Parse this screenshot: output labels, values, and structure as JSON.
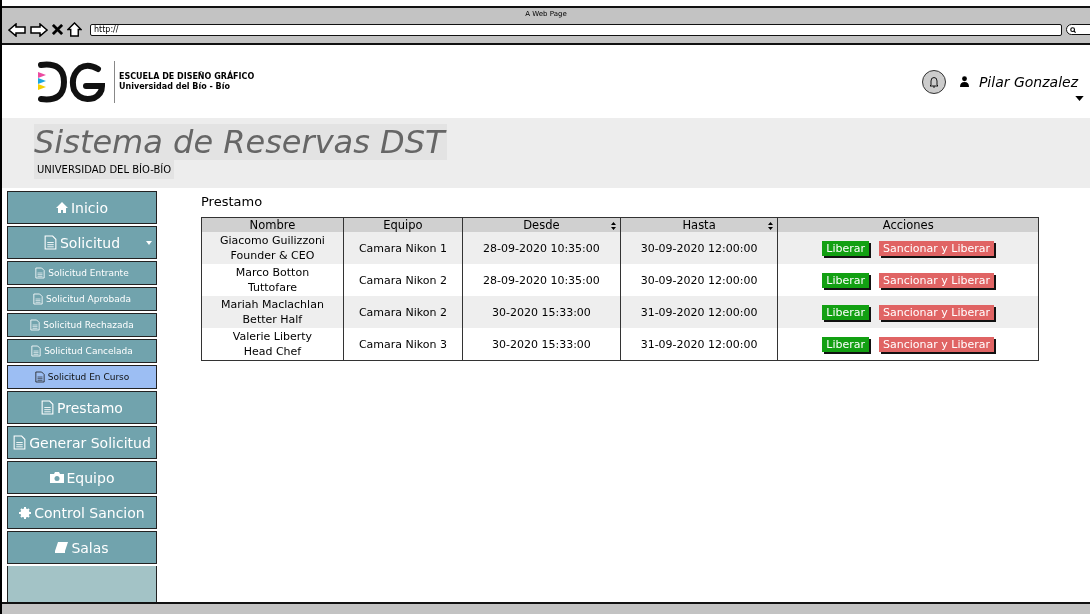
{
  "browser": {
    "title": "A Web Page",
    "url": "http://"
  },
  "header": {
    "logo_lines": [
      "ESCUELA DE DISEÑO GRÁFICO",
      "Universidad del Bío - Bío"
    ],
    "user": "Pilar Gonzalez"
  },
  "banner": {
    "title": "Sistema de Reservas DST",
    "subtitle": "UNIVERSIDAD DEL BÍO-BÍO"
  },
  "sidebar": {
    "items": [
      {
        "label": "Inicio",
        "kind": "main",
        "selected": false,
        "expanded": false
      },
      {
        "label": "Solicitud",
        "kind": "main",
        "selected": false,
        "expanded": true
      },
      {
        "label": "Solicitud Entrante",
        "kind": "sub",
        "selected": false,
        "expanded": false
      },
      {
        "label": "Solicitud Aprobada",
        "kind": "sub",
        "selected": false,
        "expanded": false
      },
      {
        "label": "Solicitud Rechazada",
        "kind": "sub",
        "selected": false,
        "expanded": false
      },
      {
        "label": "Solicitud Cancelada",
        "kind": "sub",
        "selected": false,
        "expanded": false
      },
      {
        "label": "Solicitud En Curso",
        "kind": "sub",
        "selected": true,
        "expanded": false
      },
      {
        "label": "Prestamo",
        "kind": "main",
        "selected": false,
        "expanded": false
      },
      {
        "label": "Generar Solicitud",
        "kind": "main",
        "selected": false,
        "expanded": false
      },
      {
        "label": "Equipo",
        "kind": "main",
        "selected": false,
        "expanded": false
      },
      {
        "label": "Control Sancion",
        "kind": "main",
        "selected": false,
        "expanded": false
      },
      {
        "label": "Salas",
        "kind": "main",
        "selected": false,
        "expanded": false
      }
    ]
  },
  "content": {
    "title": "Prestamo",
    "table": {
      "columns": [
        {
          "label": "Nombre",
          "sortable": false
        },
        {
          "label": "Equipo",
          "sortable": false
        },
        {
          "label": "Desde",
          "sortable": true
        },
        {
          "label": "Hasta",
          "sortable": true
        },
        {
          "label": "Acciones",
          "sortable": false
        }
      ],
      "rows": [
        {
          "name": "Giacomo Guilizzoni",
          "role": "Founder & CEO",
          "equipo": "Camara Nikon 1",
          "desde": "28-09-2020 10:35:00",
          "hasta": "30-09-2020 12:00:00",
          "actions": [
            "Liberar",
            "Sancionar y Liberar"
          ]
        },
        {
          "name": "Marco Botton",
          "role": "Tuttofare",
          "equipo": "Camara Nikon 2",
          "desde": "28-09-2020 10:35:00",
          "hasta": "30-09-2020 12:00:00",
          "actions": [
            "Liberar",
            "Sancionar y Liberar"
          ]
        },
        {
          "name": "Mariah Maclachlan",
          "role": "Better Half",
          "equipo": "Camara Nikon 2",
          "desde": "30-2020 15:33:00",
          "hasta": "31-09-2020 12:00:00",
          "actions": [
            "Liberar",
            "Sancionar y Liberar"
          ]
        },
        {
          "name": "Valerie Liberty",
          "role": "Head Chef",
          "equipo": "Camara Nikon 3",
          "desde": "30-2020 15:33:00",
          "hasta": "31-09-2020 12:00:00",
          "actions": [
            "Liberar",
            "Sancionar y Liberar"
          ]
        }
      ]
    }
  }
}
